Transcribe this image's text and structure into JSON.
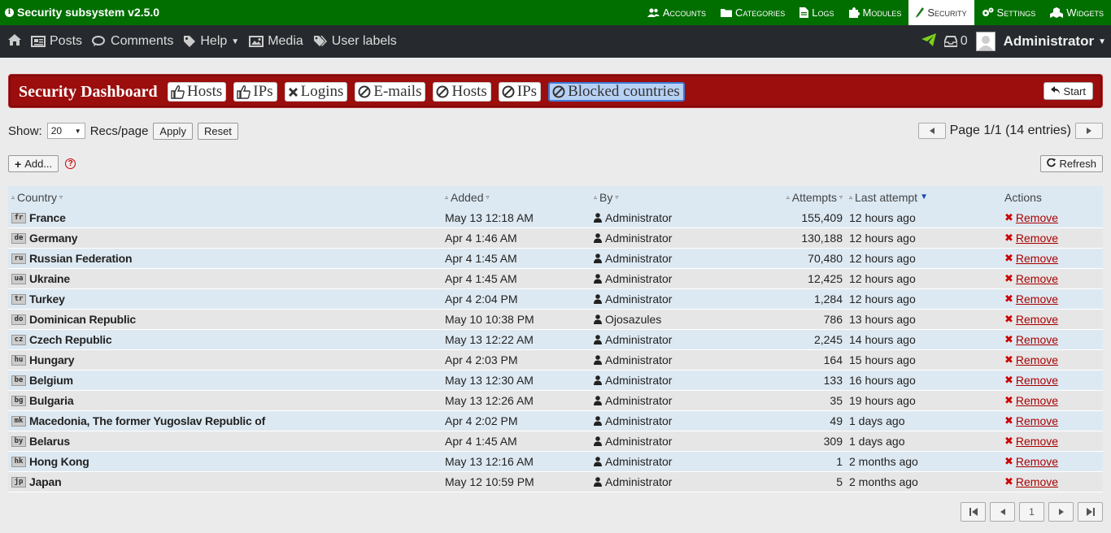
{
  "app": {
    "title": "Security subsystem v2.5.0"
  },
  "topnav": [
    {
      "label": "Accounts",
      "icon": "users-icon"
    },
    {
      "label": "Categories",
      "icon": "folder-icon"
    },
    {
      "label": "Logs",
      "icon": "file-icon"
    },
    {
      "label": "Modules",
      "icon": "puzzle-icon"
    },
    {
      "label": "Security",
      "icon": "shield-icon",
      "active": true
    },
    {
      "label": "Settings",
      "icon": "gears-icon"
    },
    {
      "label": "Widgets",
      "icon": "cubes-icon"
    }
  ],
  "navbar": {
    "items": [
      "Posts",
      "Comments",
      "Help",
      "Media",
      "User labels"
    ],
    "notifications": "0",
    "user": "Administrator"
  },
  "dashboard": {
    "title": "Security Dashboard",
    "tabs": [
      {
        "label": "Hosts",
        "icon": "thumbs-up-icon"
      },
      {
        "label": "IPs",
        "icon": "thumbs-up-icon"
      },
      {
        "label": "Logins",
        "icon": "times-icon"
      },
      {
        "label": "E-mails",
        "icon": "ban-icon"
      },
      {
        "label": "Hosts",
        "icon": "ban-icon"
      },
      {
        "label": "IPs",
        "icon": "ban-icon"
      },
      {
        "label": "Blocked countries",
        "icon": "ban-icon",
        "active": true
      }
    ],
    "start_label": "Start"
  },
  "controls": {
    "show_label": "Show:",
    "recs_value": "20",
    "recs_label": "Recs/page",
    "apply_label": "Apply",
    "reset_label": "Reset",
    "page_info": "Page 1/1 (14 entries)",
    "add_label": "Add...",
    "refresh_label": "Refresh"
  },
  "table": {
    "headers": {
      "country": "Country",
      "added": "Added",
      "by": "By",
      "attempts": "Attempts",
      "last": "Last attempt",
      "actions": "Actions"
    },
    "remove_label": "Remove",
    "rows": [
      {
        "code": "fr",
        "country": "France",
        "added": "May 13 12:18 AM",
        "by": "Administrator",
        "attempts": "155,409",
        "last": "12 hours ago"
      },
      {
        "code": "de",
        "country": "Germany",
        "added": "Apr 4 1:46 AM",
        "by": "Administrator",
        "attempts": "130,188",
        "last": "12 hours ago"
      },
      {
        "code": "ru",
        "country": "Russian Federation",
        "added": "Apr 4 1:45 AM",
        "by": "Administrator",
        "attempts": "70,480",
        "last": "12 hours ago"
      },
      {
        "code": "ua",
        "country": "Ukraine",
        "added": "Apr 4 1:45 AM",
        "by": "Administrator",
        "attempts": "12,425",
        "last": "12 hours ago"
      },
      {
        "code": "tr",
        "country": "Turkey",
        "added": "Apr 4 2:04 PM",
        "by": "Administrator",
        "attempts": "1,284",
        "last": "12 hours ago"
      },
      {
        "code": "do",
        "country": "Dominican Republic",
        "added": "May 10 10:38 PM",
        "by": "Ojosazules",
        "attempts": "786",
        "last": "13 hours ago"
      },
      {
        "code": "cz",
        "country": "Czech Republic",
        "added": "May 13 12:22 AM",
        "by": "Administrator",
        "attempts": "2,245",
        "last": "14 hours ago"
      },
      {
        "code": "hu",
        "country": "Hungary",
        "added": "Apr 4 2:03 PM",
        "by": "Administrator",
        "attempts": "164",
        "last": "15 hours ago"
      },
      {
        "code": "be",
        "country": "Belgium",
        "added": "May 13 12:30 AM",
        "by": "Administrator",
        "attempts": "133",
        "last": "16 hours ago"
      },
      {
        "code": "bg",
        "country": "Bulgaria",
        "added": "May 13 12:26 AM",
        "by": "Administrator",
        "attempts": "35",
        "last": "19 hours ago"
      },
      {
        "code": "mk",
        "country": "Macedonia, The former Yugoslav Republic of",
        "added": "Apr 4 2:02 PM",
        "by": "Administrator",
        "attempts": "49",
        "last": "1 days ago"
      },
      {
        "code": "by",
        "country": "Belarus",
        "added": "Apr 4 1:45 AM",
        "by": "Administrator",
        "attempts": "309",
        "last": "1 days ago"
      },
      {
        "code": "hk",
        "country": "Hong Kong",
        "added": "May 13 12:16 AM",
        "by": "Administrator",
        "attempts": "1",
        "last": "2 months ago"
      },
      {
        "code": "jp",
        "country": "Japan",
        "added": "May 12 10:59 PM",
        "by": "Administrator",
        "attempts": "5",
        "last": "2 months ago"
      }
    ]
  },
  "pager_bottom": {
    "current": "1"
  },
  "colors": {
    "topbar": "#006f00",
    "navbar": "#262a2e",
    "dashboard": "#9c0d0d",
    "remove": "#aa0000"
  }
}
